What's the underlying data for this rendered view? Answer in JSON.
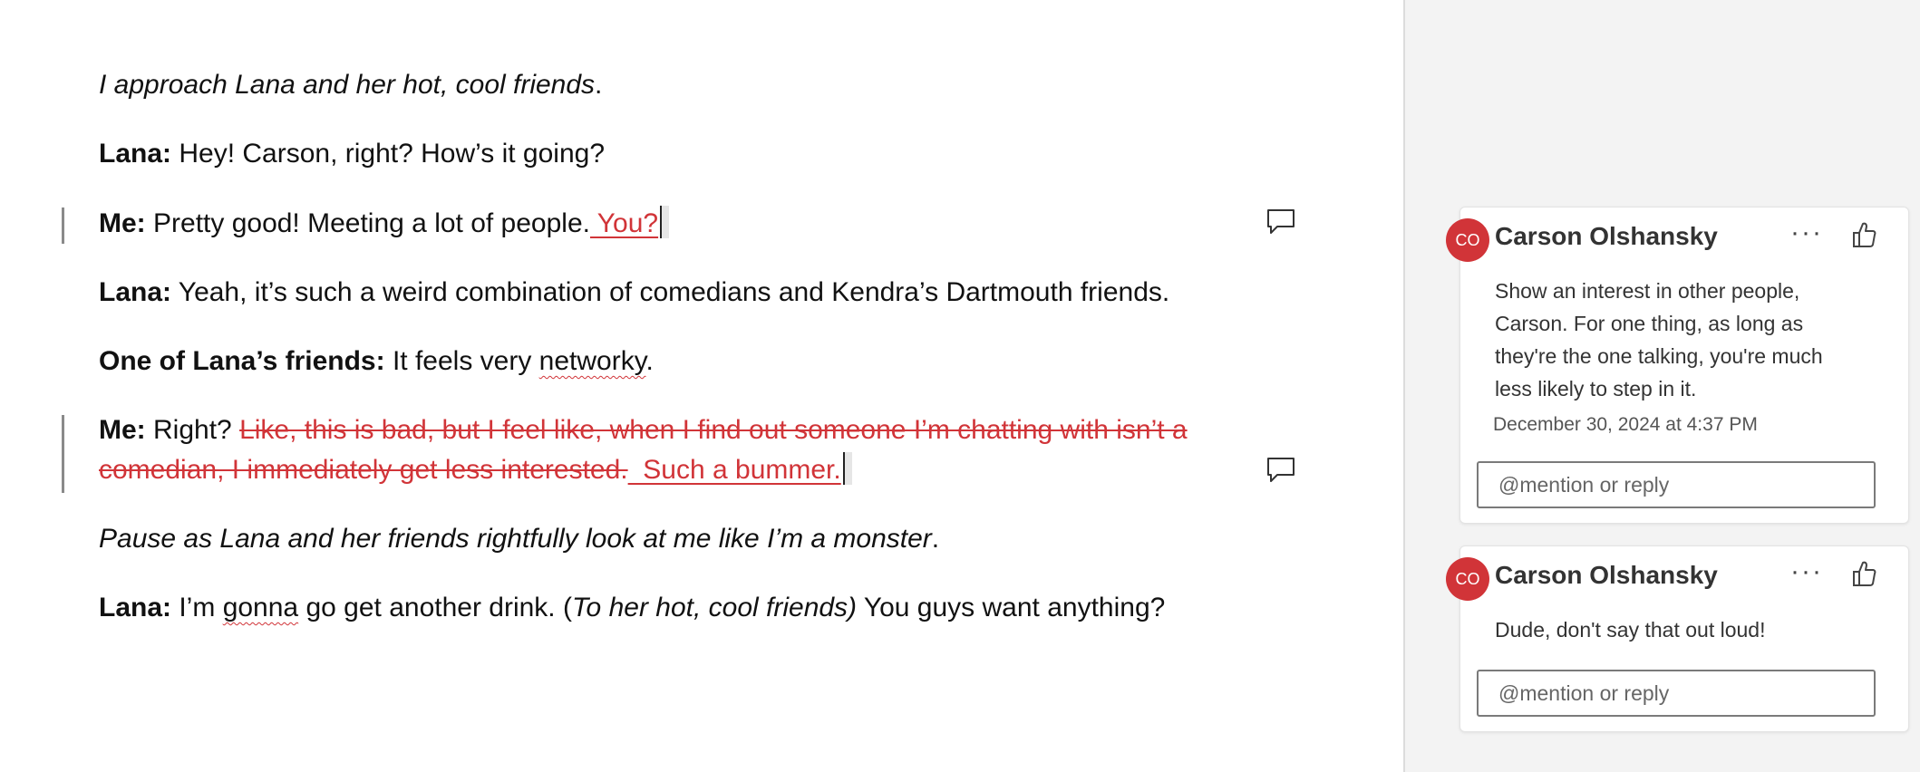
{
  "document": {
    "p1": {
      "text": "I approach Lana and her hot, cool friends",
      "end": "."
    },
    "p2": {
      "speaker": "Lana:",
      "text": " Hey! Carson, right? How’s it going?"
    },
    "p3": {
      "speaker": "Me:",
      "text": " Pretty good! Meeting a lot of people.",
      "inserted": " You?"
    },
    "p4": {
      "speaker": "Lana:",
      "text": " Yeah, it’s such a weird combination of comedians and Kendra’s Dartmouth friends."
    },
    "p5": {
      "speaker": "One of Lana’s friends:",
      "text_before": " It feels very ",
      "misspelled": "networky",
      "text_after": "."
    },
    "p6": {
      "speaker": "Me:",
      "text": " Right? ",
      "deleted_line1": "Like, this is bad, but I feel like, when I find out someone I’m chatting with isn’t a ",
      "deleted_line2": "comedian, I immediately get less interested.",
      "inserted": "  Such a bummer."
    },
    "p7": {
      "text": "Pause as Lana and her friends rightfully look at me like I’m a monster",
      "end": "."
    },
    "p8": {
      "speaker": "Lana:",
      "text_before": " I’m ",
      "misspelled": "gonna",
      "text_mid": " go get another drink. (",
      "italic": "To her hot, cool friends)",
      "text_after": " You guys want anything?"
    }
  },
  "comments": [
    {
      "initials": "CO",
      "author": "Carson Olshansky",
      "more": "···",
      "body_lines": [
        "Show an interest in other people,",
        "Carson. For one thing, as long as",
        "they're the one talking, you're much",
        "less likely to step in it."
      ],
      "date": "December 30, 2024 at 4:37 PM",
      "reply_placeholder": "@mention or reply"
    },
    {
      "initials": "CO",
      "author": "Carson Olshansky",
      "more": "···",
      "body_lines": [
        "Dude, don't say that out loud!"
      ],
      "reply_placeholder": "@mention or reply"
    }
  ],
  "colors": {
    "accent": "#d13438",
    "pane_bg": "#f3f3f3"
  }
}
